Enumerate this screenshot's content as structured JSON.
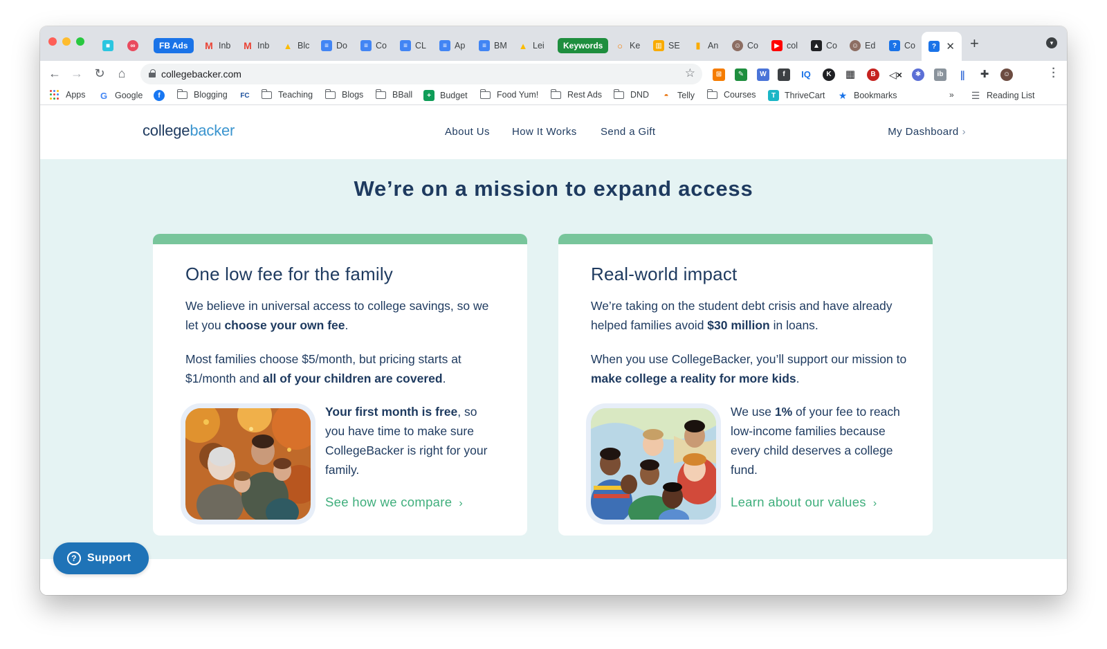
{
  "browser": {
    "tabs": [
      {
        "label": "",
        "icon": "app-square-icon",
        "color": "#2bc6e0"
      },
      {
        "label": "",
        "icon": "loop-icon",
        "color": "#e94b5e"
      },
      {
        "label": "FB Ads",
        "pill": true,
        "color": "#1a73e8"
      },
      {
        "label": "Inb",
        "icon": "gmail-icon",
        "color": "#ea4335"
      },
      {
        "label": "Inb",
        "icon": "gmail-icon",
        "color": "#ea4335"
      },
      {
        "label": "Blc",
        "icon": "drive-icon",
        "color": "#fbbc04"
      },
      {
        "label": "Do",
        "icon": "docs-icon",
        "color": "#4285f4"
      },
      {
        "label": "Co",
        "icon": "docs-icon",
        "color": "#4285f4"
      },
      {
        "label": "CL",
        "icon": "docs-icon",
        "color": "#4285f4"
      },
      {
        "label": "Ap",
        "icon": "docs-icon",
        "color": "#4285f4"
      },
      {
        "label": "BM",
        "icon": "docs-icon",
        "color": "#4285f4"
      },
      {
        "label": "Lei",
        "icon": "drive-icon",
        "color": "#fbbc04"
      },
      {
        "label": "Keywords",
        "pill": true,
        "color": "#1e8e3e"
      },
      {
        "label": "Ke",
        "icon": "key-icon",
        "color": "#f57c00"
      },
      {
        "label": "SE",
        "icon": "chart-icon",
        "color": "#f9ab00"
      },
      {
        "label": "An",
        "icon": "analytics-icon",
        "color": "#f9ab00"
      },
      {
        "label": "Co",
        "icon": "avatar-icon",
        "color": "#8d6e63"
      },
      {
        "label": "col",
        "icon": "youtube-icon",
        "color": "#ff0000"
      },
      {
        "label": "Co",
        "icon": "graduation-cap-icon",
        "color": "#202124"
      },
      {
        "label": "Ed",
        "icon": "avatar-icon",
        "color": "#8d6e63"
      },
      {
        "label": "Co",
        "icon": "chat-icon",
        "color": "#1a73e8"
      },
      {
        "label": "",
        "icon": "chat-icon",
        "color": "#1a73e8",
        "active": true
      }
    ],
    "url": "collegebacker.com",
    "bookmarks": [
      {
        "label": "Apps",
        "kind": "apps"
      },
      {
        "label": "Google",
        "kind": "google"
      },
      {
        "label": "",
        "kind": "facebook"
      },
      {
        "label": "Blogging",
        "kind": "folder"
      },
      {
        "label": "",
        "kind": "fc"
      },
      {
        "label": "Teaching",
        "kind": "folder"
      },
      {
        "label": "Blogs",
        "kind": "folder"
      },
      {
        "label": "BBall",
        "kind": "folder"
      },
      {
        "label": "Budget",
        "kind": "sheets"
      },
      {
        "label": "Food Yum!",
        "kind": "folder"
      },
      {
        "label": "Rest Ads",
        "kind": "folder"
      },
      {
        "label": "DND",
        "kind": "folder"
      },
      {
        "label": "Telly",
        "kind": "telly"
      },
      {
        "label": "Courses",
        "kind": "folder"
      },
      {
        "label": "ThriveCart",
        "kind": "thrivecart"
      },
      {
        "label": "Bookmarks",
        "kind": "star"
      }
    ],
    "overflow": "»",
    "reading_list": "Reading List"
  },
  "site": {
    "logo_part1": "college",
    "logo_part2": "backer",
    "nav": [
      "About Us",
      "How It Works",
      "Send a Gift"
    ],
    "dashboard": "My Dashboard",
    "hero_title": "We’re on a mission to expand access",
    "cards": [
      {
        "title": "One low fee for the family",
        "p1_a": "We believe in universal access to college savings, so we let you ",
        "p1_b": "choose your own fee",
        "p1_c": ".",
        "p2_a": "Most families choose $5/month, but pricing starts at $1/month and ",
        "p2_b": "all of your children are covered",
        "p2_c": ".",
        "side_b": "Your first month is free",
        "side_a": ", so you have time to make sure CollegeBacker is right for your family.",
        "link": "See how we compare",
        "photo": "family-autumn-photo"
      },
      {
        "title": "Real-world impact",
        "p1_a": "We’re taking on the student debt crisis and have already helped families avoid ",
        "p1_b": "$30 million",
        "p1_c": " in loans.",
        "p2_a": "When you use CollegeBacker, you’ll support our mission to ",
        "p2_b": "make college a reality for more kids",
        "p2_c": ".",
        "side_pre": "We use ",
        "side_b": "1%",
        "side_a": " of your fee to reach low-income families because every child deserves a college fund.",
        "link": "Learn about our values",
        "photo": "children-group-photo"
      }
    ],
    "support": "Support",
    "colors": {
      "navy": "#1e3a5f",
      "accent_green": "#3fae7c",
      "card_bar": "#78c59b",
      "hero_bg": "#e5f3f3",
      "support_blue": "#1f73b7"
    }
  }
}
